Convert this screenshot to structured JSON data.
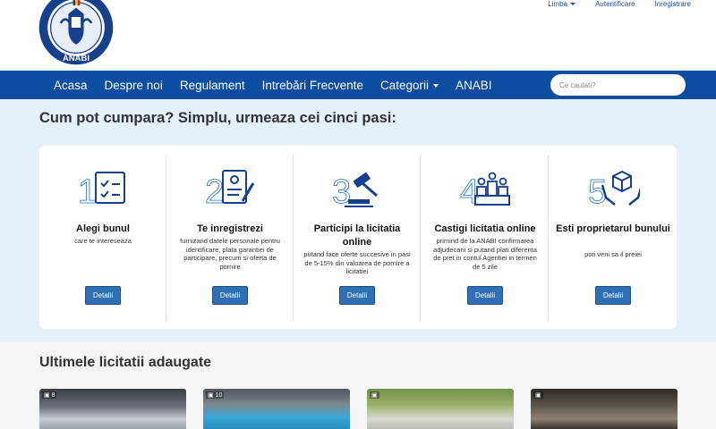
{
  "header": {
    "logo_text": "ANABI",
    "top_links": {
      "language": "Limba",
      "login": "Autentificare",
      "register": "Inregistrare"
    }
  },
  "nav": {
    "items": [
      "Acasa",
      "Despre noi",
      "Regulament",
      "Intrebări Frecvente",
      "Categorii",
      "ANABI"
    ],
    "search_placeholder": "Ce cautati?"
  },
  "steps": {
    "title": "Cum pot cumpara? Simplu, urmeaza cei cinci pasi:",
    "button_label": "Detalii",
    "items": [
      {
        "number": "1",
        "icon": "checklist-icon",
        "title": "Alegi bunul",
        "desc": "care te intereseaza"
      },
      {
        "number": "2",
        "icon": "registration-form-icon",
        "title": "Te inregistrezi",
        "desc": "furnizand datele personale pentru identificare, plata garantiei de participare, precum si oferta de pornire"
      },
      {
        "number": "3",
        "icon": "auction-gavel-icon",
        "title": "Participi la licitatia online",
        "desc": "putand face oferte succesive in pasi de 5-15% din valoarea de pornire a licitatiei"
      },
      {
        "number": "4",
        "icon": "winners-podium-icon",
        "title": "Castigi licitatia online",
        "desc": "primind de la ANABI confirmarea adjudecarii si putand plati diferenta de pret in contul Agentiei in termen de 5 zile"
      },
      {
        "number": "5",
        "icon": "hands-box-icon",
        "title": "Esti proprietarul bunului",
        "desc": "poti veni sa il preiei"
      }
    ]
  },
  "latest": {
    "title": "Ultimele licitatii adaugate",
    "listings": [
      {
        "photo_count": "8"
      },
      {
        "photo_count": "10"
      },
      {
        "photo_count": ""
      },
      {
        "photo_count": ""
      }
    ]
  },
  "colors": {
    "nav_bg": "#0d4da1",
    "section_bg": "#e4f0fb",
    "button": "#2f6fb6",
    "icon_blue": "#1b6fc4"
  }
}
